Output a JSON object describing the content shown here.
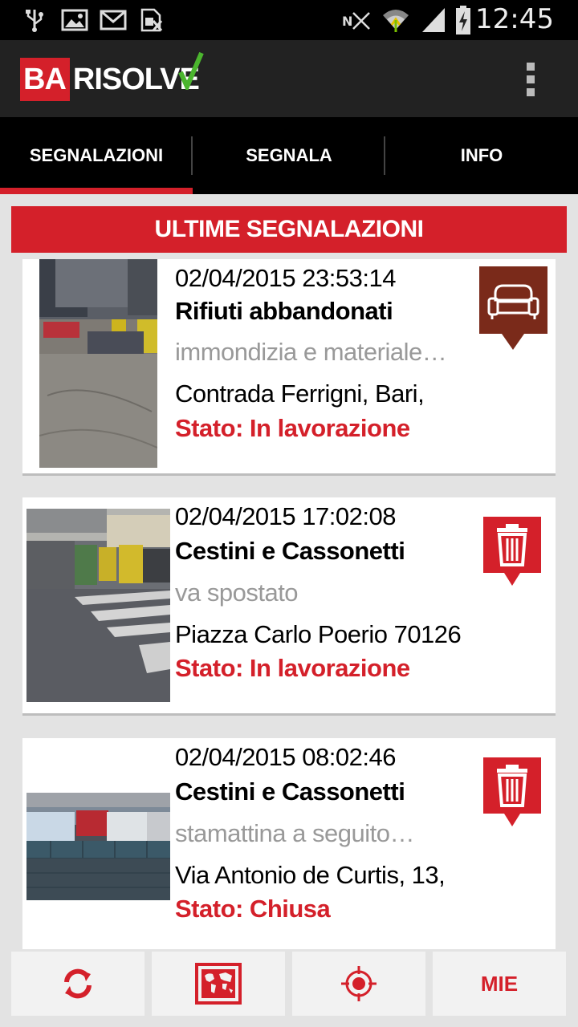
{
  "status_bar": {
    "time": "12:45",
    "icons": [
      "usb-icon",
      "image-icon",
      "gmail-icon",
      "sim-icon",
      "nfc-icon",
      "wifi-icon",
      "signal-icon",
      "battery-icon"
    ]
  },
  "app": {
    "logo_prefix": "BA",
    "logo_suffix": "RISOLVE",
    "menu_icon": "overflow-menu-icon"
  },
  "tabs": [
    {
      "label": "SEGNALAZIONI",
      "active": true
    },
    {
      "label": "SEGNALA",
      "active": false
    },
    {
      "label": "INFO",
      "active": false
    }
  ],
  "section_title": "ULTIME SEGNALAZIONI",
  "reports": [
    {
      "date": "02/04/2015 23:53:14",
      "category": "Rifiuti abbandonati",
      "description": "immondizia e materiale…",
      "address": "Contrada Ferrigni, Bari,",
      "status": "Stato: In lavorazione",
      "category_icon": "sofa-icon",
      "icon_color": "#7a2a1a"
    },
    {
      "date": "02/04/2015 17:02:08",
      "category": "Cestini e Cassonetti",
      "description": "va spostato",
      "address": "Piazza Carlo Poerio 70126",
      "status": "Stato: In lavorazione",
      "category_icon": "trash-bin-icon",
      "icon_color": "#d4202a"
    },
    {
      "date": "02/04/2015 08:02:46",
      "category": "Cestini e Cassonetti",
      "description": "stamattina a seguito…",
      "address": "Via Antonio de Curtis, 13,",
      "status": "Stato: Chiusa",
      "category_icon": "trash-bin-icon",
      "icon_color": "#d4202a"
    }
  ],
  "bottom_bar": {
    "buttons": [
      {
        "icon": "refresh-icon"
      },
      {
        "icon": "world-map-icon"
      },
      {
        "icon": "locate-icon"
      },
      {
        "label": "MIE"
      }
    ]
  },
  "colors": {
    "accent": "#d4202a",
    "appbar": "#222222",
    "tabbar": "#000000",
    "background": "#e3e3e3"
  }
}
